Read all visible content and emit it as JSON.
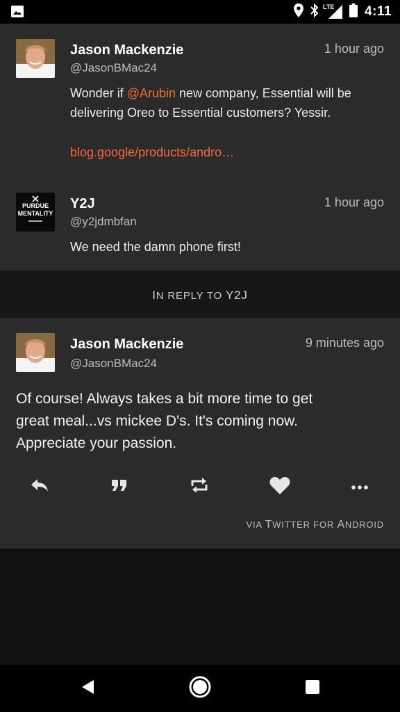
{
  "status_bar": {
    "time": "4:11",
    "network": "LTE",
    "icons": [
      "gallery-icon",
      "location-icon",
      "bluetooth-icon",
      "signal-icon",
      "battery-icon"
    ]
  },
  "tweets": [
    {
      "author": "Jason Mackenzie",
      "handle": "@JasonBMac24",
      "time": "1 hour ago",
      "text_before": "Wonder if ",
      "mention": "@Arubin",
      "text_after": " new company, Essential will be delivering Oreo to Essential customers? Yessir.",
      "link": "blog.google/products/andro…"
    },
    {
      "author": "Y2J",
      "handle": "@y2jdmbfan",
      "time": "1 hour ago",
      "text": "We need the damn phone first!"
    }
  ],
  "reply_context": {
    "prefix_big": "I",
    "prefix": "N REPLY TO ",
    "target": "Y2J"
  },
  "main_tweet": {
    "author": "Jason Mackenzie",
    "handle": "@JasonBMac24",
    "time": "9 minutes ago",
    "text_line1": "Of course!  Always takes a bit more time to get",
    "text_line2": "great meal...vs mickee D's.  It's coming now.",
    "text_line3": "Appreciate your passion.",
    "via_prefix": "VIA ",
    "via_t": "T",
    "via_witter": "WITTER FOR ",
    "via_a": "A",
    "via_ndroid": "NDROID"
  },
  "actions": [
    "reply-icon",
    "quote-icon",
    "retweet-icon",
    "like-icon",
    "more-icon"
  ],
  "colors": {
    "accent": "#f46b3b",
    "card": "#2b2b2b",
    "background": "#121212"
  }
}
